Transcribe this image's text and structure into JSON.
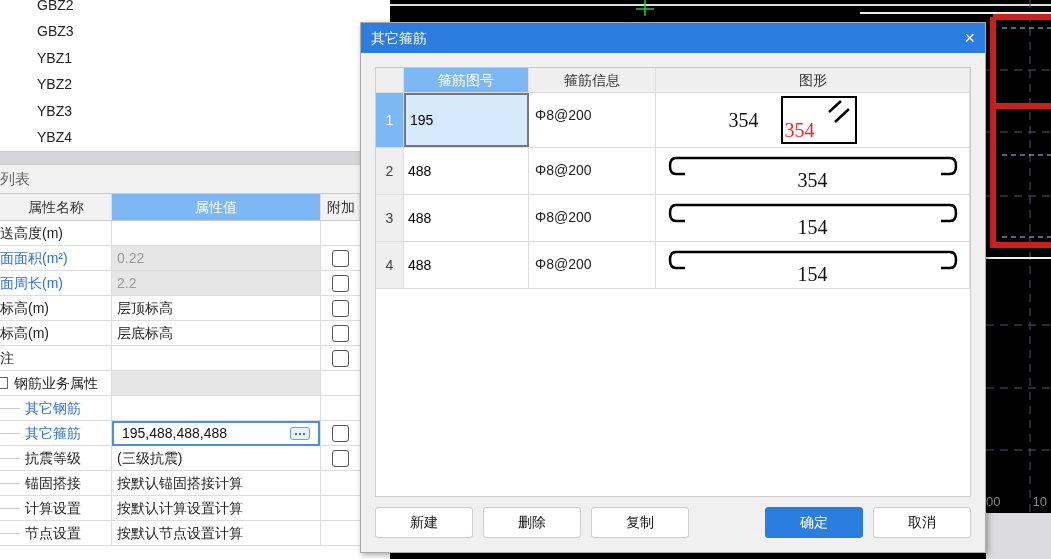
{
  "component_list": {
    "items": [
      "GBZ2",
      "GBZ3",
      "YBZ1",
      "YBZ2",
      "YBZ3",
      "YBZ4"
    ]
  },
  "property_panel": {
    "title": "列表",
    "columns": [
      "属性名称",
      "属性值",
      "附加"
    ],
    "rows": [
      {
        "name": "送高度(m)",
        "public": false,
        "disabled": false
      },
      {
        "name": "面面积(m²)",
        "value": "0.22",
        "public": true,
        "disabled": true,
        "checked": false
      },
      {
        "name": "面周长(m)",
        "value": "2.2",
        "public": true,
        "disabled": true,
        "checked": false
      },
      {
        "name": "标高(m)",
        "value": "层顶标高",
        "public": false,
        "disabled": false,
        "checked": false
      },
      {
        "name": "标高(m)",
        "value": "层底标高",
        "public": false,
        "disabled": false,
        "checked": false
      },
      {
        "name": "注",
        "public": false,
        "disabled": false,
        "checked": false
      },
      {
        "name": "钢筋业务属性",
        "public": false,
        "disabled": true,
        "expanded": true,
        "children": [
          {
            "name": "其它钢筋",
            "public": true,
            "disabled": false
          },
          {
            "name": "其它箍筋",
            "value": "195,488,488,488",
            "public": true,
            "disabled": false,
            "editing": true,
            "checked": false
          },
          {
            "name": "抗震等级",
            "value": "(三级抗震)",
            "public": false,
            "disabled": false,
            "checked": false
          },
          {
            "name": "锚固搭接",
            "value": "按默认锚固搭接计算",
            "public": false,
            "disabled": false
          },
          {
            "name": "计算设置",
            "value": "按默认计算设置计算",
            "public": false,
            "disabled": false
          },
          {
            "name": "节点设置",
            "value": "按默认节点设置计算",
            "public": false,
            "disabled": false
          }
        ]
      }
    ]
  },
  "canvas": {
    "ruler_labels": [
      "00",
      "10"
    ]
  },
  "dialog": {
    "title": "其它箍筋",
    "close": "×",
    "table": {
      "columns": [
        {
          "label": "箍筋图号",
          "selected": true
        },
        {
          "label": "箍筋信息",
          "selected": false
        },
        {
          "label": "图形",
          "selected": false
        }
      ],
      "rows": [
        {
          "index": "1",
          "selected": true,
          "shape_no": "195",
          "info": "Φ8@200",
          "shape": {
            "kind": "closed",
            "outer_label": "354",
            "inner_label": "354"
          }
        },
        {
          "index": "2",
          "selected": false,
          "shape_no": "488",
          "info": "Φ8@200",
          "shape": {
            "kind": "hooked-bar",
            "label": "354"
          }
        },
        {
          "index": "3",
          "selected": false,
          "shape_no": "488",
          "info": "Φ8@200",
          "shape": {
            "kind": "hooked-bar",
            "label": "154"
          }
        },
        {
          "index": "4",
          "selected": false,
          "shape_no": "488",
          "info": "Φ8@200",
          "shape": {
            "kind": "hooked-bar",
            "label": "154"
          }
        }
      ]
    },
    "buttons": [
      {
        "label": "新建",
        "primary": false
      },
      {
        "label": "删除",
        "primary": false
      },
      {
        "label": "复制",
        "primary": false
      },
      {
        "label": "确定",
        "primary": true
      },
      {
        "label": "取消",
        "primary": false
      }
    ]
  }
}
